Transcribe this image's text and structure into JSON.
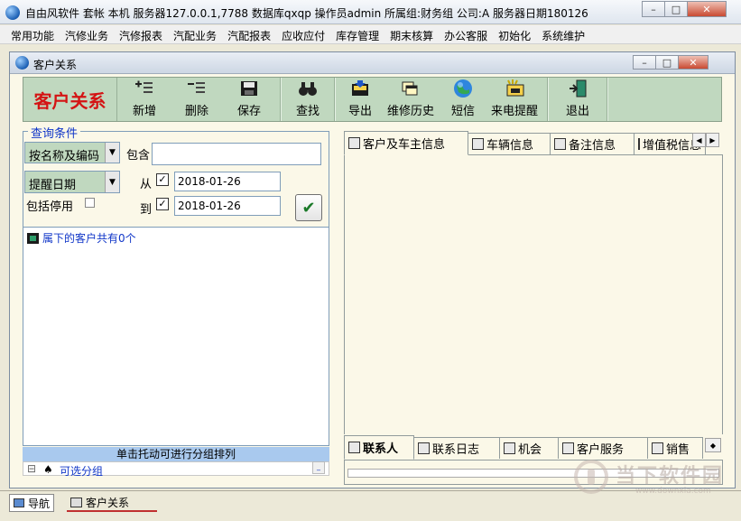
{
  "window": {
    "title": "自由风软件  套帐 本机  服务器127.0.0.1,7788  数据库qxqp  操作员admin  所属组:财务组  公司:A  服务器日期180126",
    "minimize": "–",
    "maximize": "□",
    "close": "✕"
  },
  "menubar": {
    "items": [
      "常用功能",
      "汽修业务",
      "汽修报表",
      "汽配业务",
      "汽配报表",
      "应收应付",
      "库存管理",
      "期末核算",
      "办公客服",
      "初始化",
      "系统维护"
    ]
  },
  "child_window": {
    "title": "客户关系",
    "minimize": "–",
    "maximize": "□",
    "close": "✕"
  },
  "toolbar": {
    "title": "客户关系",
    "buttons": {
      "new": "新增",
      "delete": "删除",
      "save": "保存",
      "find": "查找",
      "export": "导出",
      "repair_history": "维修历史",
      "sms": "短信",
      "call_reminder": "来电提醒",
      "exit": "退出"
    }
  },
  "query": {
    "legend": "查询条件",
    "field_select": "按名称及编码",
    "contains_label": "包含",
    "contains_value": "",
    "date_field_select": "提醒日期",
    "from_label": "从",
    "from_checked": true,
    "from_date": "2018-01-26",
    "to_label": "到",
    "to_checked": true,
    "to_date": "2018-01-26",
    "include_disabled_label": "包括停用",
    "include_disabled_checked": false,
    "ok_icon": "✔"
  },
  "tree": {
    "root_label": "属下的客户共有0个",
    "group_hint": "单击托动可进行分组排列",
    "group_option": "可选分组",
    "expand_glyph": "⊟"
  },
  "top_tabs": [
    {
      "label": "客户及车主信息",
      "icon": "id-card-icon",
      "active": true
    },
    {
      "label": "车辆信息",
      "icon": "car-icon",
      "active": false
    },
    {
      "label": "备注信息",
      "icon": "note-icon",
      "active": false
    },
    {
      "label": "增值税信息",
      "icon": "table-icon",
      "active": false
    }
  ],
  "bottom_tabs": [
    {
      "label": "联系人",
      "icon": "contact-icon",
      "active": true
    },
    {
      "label": "联系日志",
      "icon": "phone-icon",
      "active": false
    },
    {
      "label": "机会",
      "icon": "search-person-icon",
      "active": false
    },
    {
      "label": "客户服务",
      "icon": "service-icon",
      "active": false
    },
    {
      "label": "销售",
      "icon": "printer-icon",
      "active": false
    }
  ],
  "statusbar": {
    "tabs": [
      "导航",
      "客户关系"
    ]
  },
  "watermark": {
    "text": "当下软件园",
    "url": "www.downxia.com"
  }
}
